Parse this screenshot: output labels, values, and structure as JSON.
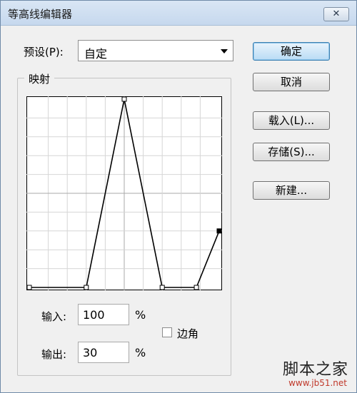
{
  "window": {
    "title": "等高线编辑器",
    "close_glyph": "✕"
  },
  "preset": {
    "label": "预设(P):",
    "value": "自定"
  },
  "mapping": {
    "group_label": "映射"
  },
  "fields": {
    "input_label": "输入:",
    "input_value": "100",
    "output_label": "输出:",
    "output_value": "30",
    "percent": "%",
    "edge_label": "边角",
    "edge_checked": false
  },
  "buttons": {
    "ok": "确定",
    "cancel": "取消",
    "load": "载入(L)...",
    "save": "存储(S)...",
    "new": "新建..."
  },
  "watermark": {
    "cn": "脚本之家",
    "url": "www.jb51.net"
  },
  "curve": {
    "points": [
      [
        0,
        0
      ],
      [
        30,
        0
      ],
      [
        50,
        100
      ],
      [
        70,
        0
      ],
      [
        88,
        0
      ],
      [
        100,
        30
      ]
    ],
    "selected_index": 5
  }
}
